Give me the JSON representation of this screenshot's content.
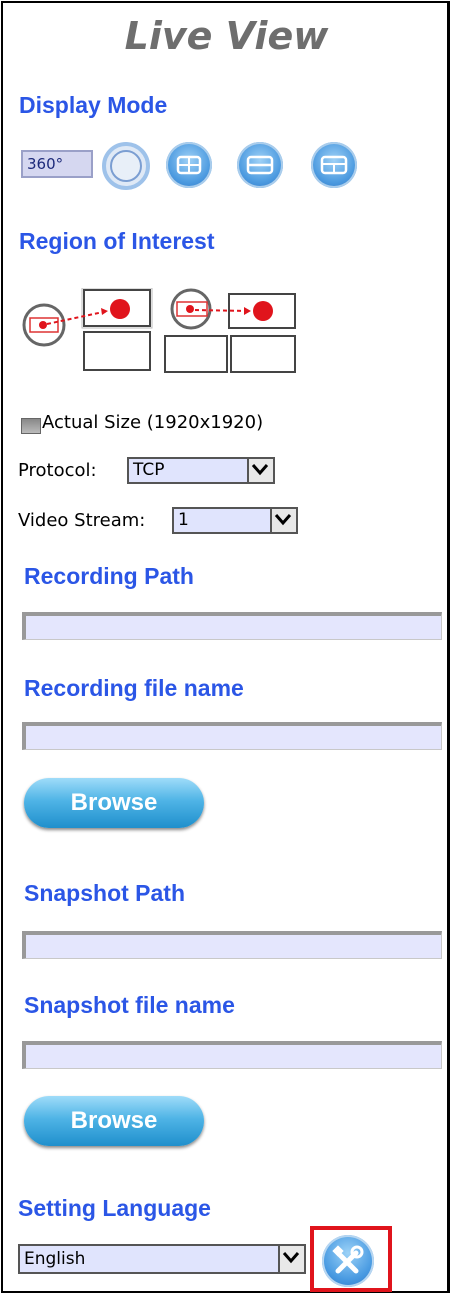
{
  "title": "Live View",
  "display_mode": {
    "heading": "Display Mode",
    "btn_360_label": "360°"
  },
  "roi": {
    "heading": "Region of Interest"
  },
  "actual_size": {
    "label": "Actual Size (1920x1920)"
  },
  "protocol": {
    "label": "Protocol:",
    "value": "TCP"
  },
  "video_stream": {
    "label": "Video Stream:",
    "value": "1"
  },
  "recording": {
    "path_heading": "Recording Path",
    "file_heading": "Recording file name",
    "path_value": "",
    "file_value": "",
    "browse_label": "Browse"
  },
  "snapshot": {
    "path_heading": "Snapshot Path",
    "file_heading": "Snapshot file name",
    "path_value": "",
    "file_value": "",
    "browse_label": "Browse"
  },
  "language": {
    "heading": "Setting Language",
    "value": "English"
  },
  "colors": {
    "heading_blue": "#2b56e6",
    "field_bg": "#e4e6fd",
    "highlight_red": "#e0141c"
  },
  "icons": [
    "view-360-icon",
    "circle-icon",
    "quad-view-icon",
    "dual-view-icon",
    "triple-view-icon",
    "roi-single-icon",
    "roi-dual-icon",
    "dropdown-arrow-icon",
    "tools-icon"
  ]
}
